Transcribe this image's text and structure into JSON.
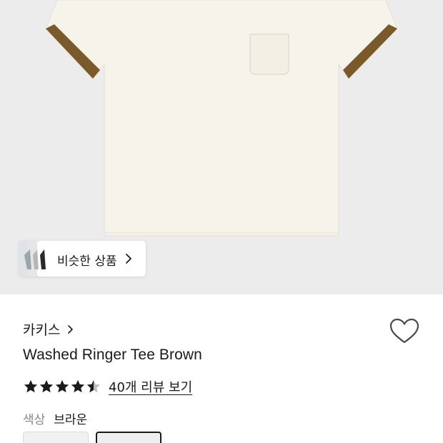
{
  "hero": {
    "background": "#ececec",
    "product_image": "shirt-photo",
    "shirt_color": "#f6f3ea",
    "cuff_color": "#7a5a2b"
  },
  "similar": {
    "label": "비슷한 상품",
    "icon": "chevron-right-icon"
  },
  "product": {
    "brand": "카키스",
    "title": "Washed Ringer Tee Brown",
    "rating": 4.5,
    "rating_max": 5,
    "review_link": "40개 리뷰 보기",
    "color_key": "색상",
    "color_value": "브라운"
  },
  "colors": {
    "star": "#1a1a1a",
    "star_empty": "#bdbdbd",
    "text": "#1a1a1a",
    "muted": "#8a8a8a"
  }
}
